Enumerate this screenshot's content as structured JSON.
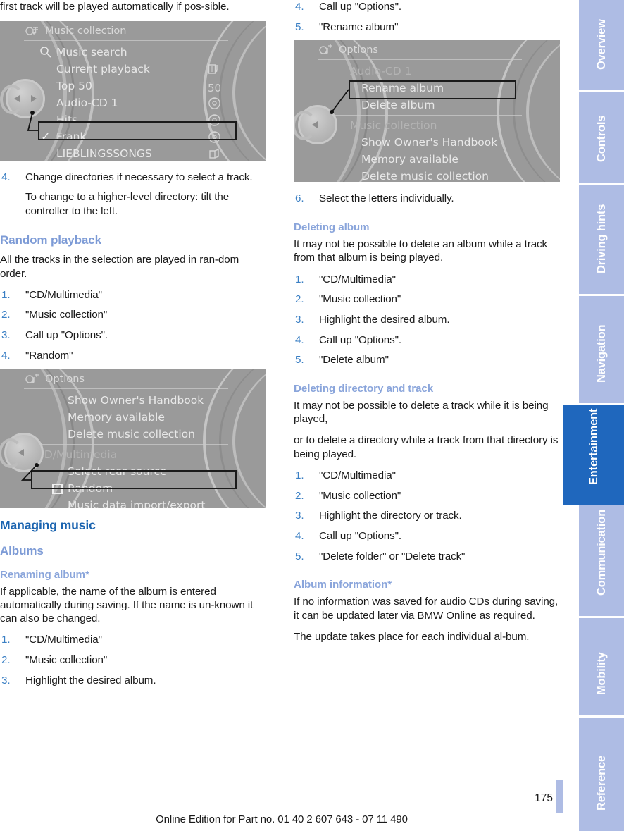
{
  "page": {
    "number": "175",
    "footer_note": "Online Edition for Part no. 01 40 2 607 643 - 07 11 490",
    "accent_blue": "#1f67bd",
    "tab_blue": "#aebce4",
    "heading_blue": "#1b64b0",
    "subheading_blue": "#7d9bd6",
    "step_number_blue": "#3a7fc4"
  },
  "tabs": [
    {
      "label": "Overview",
      "active": false
    },
    {
      "label": "Controls",
      "active": false
    },
    {
      "label": "Driving hints",
      "active": false
    },
    {
      "label": "Navigation",
      "active": false
    },
    {
      "label": "Entertainment",
      "active": true
    },
    {
      "label": "Communication",
      "active": false
    },
    {
      "label": "Mobility",
      "active": false
    },
    {
      "label": "Reference",
      "active": false
    }
  ],
  "left_column": {
    "continued_paragraph": "first track will be played automatically if pos-sible.",
    "screen_music_collection": {
      "title": "Music collection",
      "title_icon": "music-collection-icon",
      "rows": [
        {
          "label": "Music search",
          "left_icon": "magnifier-icon",
          "right_icon": "",
          "selected": false,
          "dim": false
        },
        {
          "label": "Current playback",
          "left_icon": "",
          "right_icon": "now-playing-icon",
          "selected": false,
          "dim": false
        },
        {
          "label": "Top 50",
          "left_icon": "",
          "right_icon": "50",
          "selected": false,
          "dim": false
        },
        {
          "label": "Audio-CD 1",
          "left_icon": "",
          "right_icon": "disc-icon",
          "selected": false,
          "dim": false
        },
        {
          "label": "Hits",
          "left_icon": "",
          "right_icon": "disc-icon",
          "selected": false,
          "dim": false
        },
        {
          "label": "Frank",
          "left_icon": "check-icon",
          "right_icon": "disc-icon",
          "selected": true,
          "dim": false
        },
        {
          "label": "LIEBLINGSSONGS",
          "left_icon": "",
          "right_icon": "folder-icon",
          "selected": false,
          "dim": false
        }
      ]
    },
    "step4": {
      "num": "4.",
      "text": "Change directories if necessary to select a track.",
      "sub": "To change to a higher-level directory: tilt the controller to the left."
    },
    "random_playback": {
      "heading": "Random playback",
      "intro": "All the tracks in the selection are played in ran-dom order.",
      "steps": [
        {
          "num": "1.",
          "text": "\"CD/Multimedia\""
        },
        {
          "num": "2.",
          "text": "\"Music collection\""
        },
        {
          "num": "3.",
          "text": "Call up \"Options\"."
        },
        {
          "num": "4.",
          "text": "\"Random\""
        }
      ]
    },
    "screen_options_random": {
      "title": "Options",
      "title_icon": "options-music-icon",
      "rows": [
        {
          "label": "Show Owner's Handbook",
          "selected": false,
          "dim": false,
          "checkbox": false
        },
        {
          "label": "Memory available",
          "selected": false,
          "dim": false,
          "checkbox": false
        },
        {
          "label": "Delete music collection",
          "selected": false,
          "dim": false,
          "checkbox": false
        },
        {
          "label": "CD/Multimedia",
          "selected": false,
          "dim": true,
          "checkbox": false
        },
        {
          "label": "Select rear source",
          "selected": false,
          "dim": false,
          "checkbox": false
        },
        {
          "label": "Random",
          "selected": true,
          "dim": false,
          "checkbox": true
        },
        {
          "label": "Music data import/export",
          "selected": false,
          "dim": false,
          "checkbox": false
        }
      ]
    },
    "managing_music": {
      "heading": "Managing music",
      "albums_heading": "Albums",
      "renaming_heading": "Renaming album*",
      "renaming_intro": "If applicable, the name of the album is entered automatically during saving. If the name is un-known it can also be changed.",
      "steps": [
        {
          "num": "1.",
          "text": "\"CD/Multimedia\""
        },
        {
          "num": "2.",
          "text": "\"Music collection\""
        },
        {
          "num": "3.",
          "text": "Highlight the desired album."
        }
      ]
    }
  },
  "right_column": {
    "continued_steps": [
      {
        "num": "4.",
        "text": "Call up \"Options\"."
      },
      {
        "num": "5.",
        "text": "\"Rename album\""
      }
    ],
    "screen_options_rename": {
      "title": "Options",
      "title_icon": "options-music-icon",
      "rows": [
        {
          "label": "Audio-CD 1",
          "selected": false,
          "dim": true
        },
        {
          "label": "Rename album",
          "selected": true,
          "dim": false
        },
        {
          "label": "Delete album",
          "selected": false,
          "dim": false
        },
        {
          "label": "Music collection",
          "selected": false,
          "dim": true
        },
        {
          "label": "Show Owner's Handbook",
          "selected": false,
          "dim": false
        },
        {
          "label": "Memory available",
          "selected": false,
          "dim": false
        },
        {
          "label": "Delete music collection",
          "selected": false,
          "dim": false
        }
      ]
    },
    "step6": {
      "num": "6.",
      "text": "Select the letters individually."
    },
    "deleting_album": {
      "heading": "Deleting album",
      "intro": "It may not be possible to delete an album while a track from that album is being played.",
      "steps": [
        {
          "num": "1.",
          "text": "\"CD/Multimedia\""
        },
        {
          "num": "2.",
          "text": "\"Music collection\""
        },
        {
          "num": "3.",
          "text": "Highlight the desired album."
        },
        {
          "num": "4.",
          "text": "Call up \"Options\"."
        },
        {
          "num": "5.",
          "text": "\"Delete album\""
        }
      ]
    },
    "deleting_directory": {
      "heading": "Deleting directory and track",
      "intro1": "It may not be possible to delete a track while it is being played,",
      "intro2": "or to delete a directory while a track from that directory is being played.",
      "steps": [
        {
          "num": "1.",
          "text": "\"CD/Multimedia\""
        },
        {
          "num": "2.",
          "text": "\"Music collection\""
        },
        {
          "num": "3.",
          "text": "Highlight the directory or track."
        },
        {
          "num": "4.",
          "text": "Call up \"Options\"."
        },
        {
          "num": "5.",
          "text": "\"Delete folder\" or \"Delete track\""
        }
      ]
    },
    "album_information": {
      "heading": "Album information*",
      "para1": "If no information was saved for audio CDs during saving, it can be updated later via BMW Online as required.",
      "para2": "The update takes place for each individual al-bum."
    }
  }
}
